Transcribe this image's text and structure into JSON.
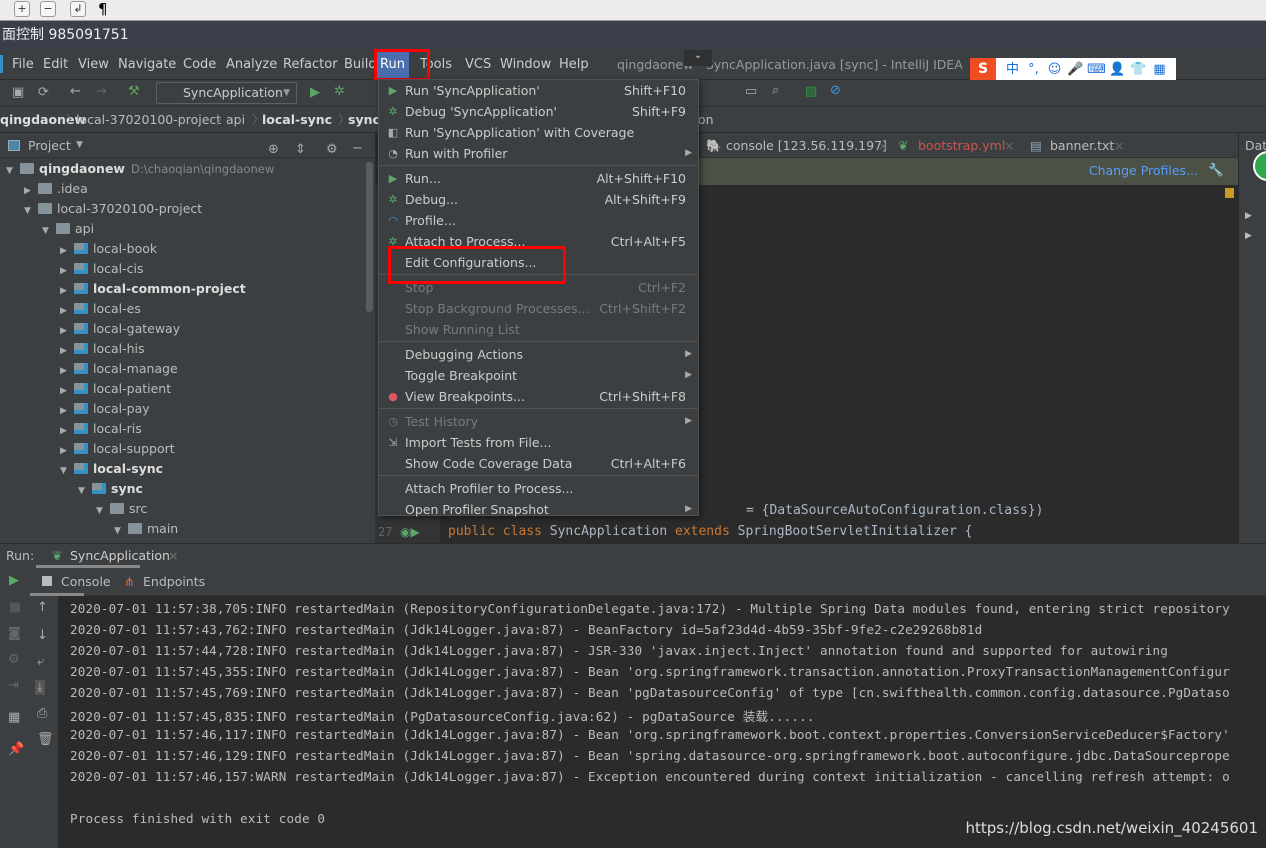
{
  "os_bar": {
    "icons": [
      "zoom-in-icon",
      "zoom-out-icon",
      "wrap-icon",
      "pilcrow-icon"
    ],
    "pilcrow": "¶"
  },
  "remote_title": "面控制 985091751",
  "menubar": [
    "File",
    "Edit",
    "View",
    "Navigate",
    "Code",
    "Analyze",
    "Refactor",
    "Build",
    "Run",
    "Tools",
    "VCS",
    "Window",
    "Help"
  ],
  "window_title": "qingdaonew - SyncApplication.java [sync] - IntelliJ IDEA",
  "ime": {
    "logo": "S",
    "items": [
      "中",
      "°,",
      "☺",
      "🎤",
      "⌨",
      "👤",
      "👕",
      "▦"
    ]
  },
  "toolbar": {
    "run_config": "SyncApplication"
  },
  "breadcrumb": [
    "qingdaonew",
    "local-37020100-project",
    "api",
    "local-sync",
    "sync",
    "...on"
  ],
  "project": {
    "title": "Project",
    "tree": [
      {
        "label": "qingdaonew",
        "extra": "D:\\chaoqian\\qingdaonew",
        "depth": 0,
        "open": true,
        "bold": true
      },
      {
        "label": ".idea",
        "depth": 1,
        "open": false
      },
      {
        "label": "local-37020100-project",
        "depth": 1,
        "open": true
      },
      {
        "label": "api",
        "depth": 2,
        "open": true
      },
      {
        "label": "local-book",
        "depth": 3,
        "open": false,
        "mod": true
      },
      {
        "label": "local-cis",
        "depth": 3,
        "open": false,
        "mod": true
      },
      {
        "label": "local-common-project",
        "depth": 3,
        "open": false,
        "mod": true,
        "bold": true
      },
      {
        "label": "local-es",
        "depth": 3,
        "open": false,
        "mod": true
      },
      {
        "label": "local-gateway",
        "depth": 3,
        "open": false,
        "mod": true
      },
      {
        "label": "local-his",
        "depth": 3,
        "open": false,
        "mod": true
      },
      {
        "label": "local-manage",
        "depth": 3,
        "open": false,
        "mod": true
      },
      {
        "label": "local-patient",
        "depth": 3,
        "open": false,
        "mod": true
      },
      {
        "label": "local-pay",
        "depth": 3,
        "open": false,
        "mod": true
      },
      {
        "label": "local-ris",
        "depth": 3,
        "open": false,
        "mod": true
      },
      {
        "label": "local-support",
        "depth": 3,
        "open": false,
        "mod": true
      },
      {
        "label": "local-sync",
        "depth": 3,
        "open": true,
        "mod": true,
        "bold": true
      },
      {
        "label": "sync",
        "depth": 4,
        "open": true,
        "mod": true,
        "bold": true
      },
      {
        "label": "src",
        "depth": 5,
        "open": true
      },
      {
        "label": "main",
        "depth": 6,
        "open": true
      }
    ]
  },
  "editor": {
    "tabs": [
      {
        "label": "console [123.56.119.197]",
        "color": "#bbbbbb"
      },
      {
        "label": "bootstrap.yml",
        "color": "#c75450"
      },
      {
        "label": "banner.txt",
        "color": "#bbbbbb"
      }
    ],
    "notification_link": "Change Profiles...",
    "line26_tail": "= {DataSourceAutoConfiguration.class})",
    "line27_num": "27",
    "line27": [
      "public ",
      "class ",
      "SyncApplication ",
      "extends ",
      "SpringBootServletInitializer {"
    ]
  },
  "right_panel": {
    "title": "Data"
  },
  "run_menu": [
    {
      "label": "Run 'SyncApplication'",
      "shortcut": "Shift+F10",
      "icon": "run-icon"
    },
    {
      "label": "Debug 'SyncApplication'",
      "shortcut": "Shift+F9",
      "icon": "debug-icon"
    },
    {
      "label": "Run 'SyncApplication' with Coverage",
      "shortcut": "",
      "icon": "coverage-icon"
    },
    {
      "label": "Run with Profiler",
      "shortcut": "",
      "icon": "profiler-icon",
      "submenu": true
    },
    {
      "sep": true
    },
    {
      "label": "Run...",
      "shortcut": "Alt+Shift+F10",
      "icon": "run-icon"
    },
    {
      "label": "Debug...",
      "shortcut": "Alt+Shift+F9",
      "icon": "debug-icon"
    },
    {
      "label": "Profile...",
      "shortcut": "",
      "icon": "profile-icon"
    },
    {
      "label": "Attach to Process...",
      "shortcut": "Ctrl+Alt+F5",
      "icon": "attach-icon"
    },
    {
      "label": "Edit Configurations...",
      "shortcut": ""
    },
    {
      "sep": true
    },
    {
      "label": "Stop",
      "shortcut": "Ctrl+F2",
      "disabled": true
    },
    {
      "label": "Stop Background Processes...",
      "shortcut": "Ctrl+Shift+F2",
      "disabled": true
    },
    {
      "label": "Show Running List",
      "shortcut": "",
      "disabled": true
    },
    {
      "sep": true
    },
    {
      "label": "Debugging Actions",
      "shortcut": "",
      "submenu": true
    },
    {
      "label": "Toggle Breakpoint",
      "shortcut": "",
      "submenu": true
    },
    {
      "label": "View Breakpoints...",
      "shortcut": "Ctrl+Shift+F8",
      "icon": "breakpoint-icon"
    },
    {
      "sep": true
    },
    {
      "label": "Test History",
      "shortcut": "",
      "disabled": true,
      "submenu": true,
      "icon": "history-icon"
    },
    {
      "label": "Import Tests from File...",
      "shortcut": "",
      "icon": "import-icon"
    },
    {
      "label": "Show Code Coverage Data",
      "shortcut": "Ctrl+Alt+F6"
    },
    {
      "sep": true
    },
    {
      "label": "Attach Profiler to Process...",
      "shortcut": ""
    },
    {
      "label": "Open Profiler Snapshot",
      "shortcut": "",
      "submenu": true
    }
  ],
  "run_panel": {
    "label": "Run:",
    "tab": "SyncApplication",
    "subtabs": [
      "Console",
      "Endpoints"
    ],
    "lines": [
      "2020-07-01 11:57:38,705:INFO restartedMain (RepositoryConfigurationDelegate.java:172) - Multiple Spring Data modules found, entering strict repository",
      "2020-07-01 11:57:43,762:INFO restartedMain (Jdk14Logger.java:87) - BeanFactory id=5af23d4d-4b59-35bf-9fe2-c2e29268b81d",
      "2020-07-01 11:57:44,728:INFO restartedMain (Jdk14Logger.java:87) - JSR-330 'javax.inject.Inject' annotation found and supported for autowiring",
      "2020-07-01 11:57:45,355:INFO restartedMain (Jdk14Logger.java:87) - Bean 'org.springframework.transaction.annotation.ProxyTransactionManagementConfigur",
      "2020-07-01 11:57:45,769:INFO restartedMain (Jdk14Logger.java:87) - Bean 'pgDatasourceConfig' of type [cn.swifthealth.common.config.datasource.PgDataso",
      "2020-07-01 11:57:45,835:INFO restartedMain (PgDatasourceConfig.java:62) - pgDataSource 装载......",
      "2020-07-01 11:57:46,117:INFO restartedMain (Jdk14Logger.java:87) - Bean 'org.springframework.boot.context.properties.ConversionServiceDeducer$Factory'",
      "2020-07-01 11:57:46,129:INFO restartedMain (Jdk14Logger.java:87) - Bean 'spring.datasource-org.springframework.boot.autoconfigure.jdbc.DataSourceprope",
      "2020-07-01 11:57:46,157:WARN restartedMain (Jdk14Logger.java:87) - Exception encountered during context initialization - cancelling refresh attempt: o",
      "",
      "Process finished with exit code 0"
    ]
  },
  "watermark": "https://blog.csdn.net/weixin_40245601"
}
